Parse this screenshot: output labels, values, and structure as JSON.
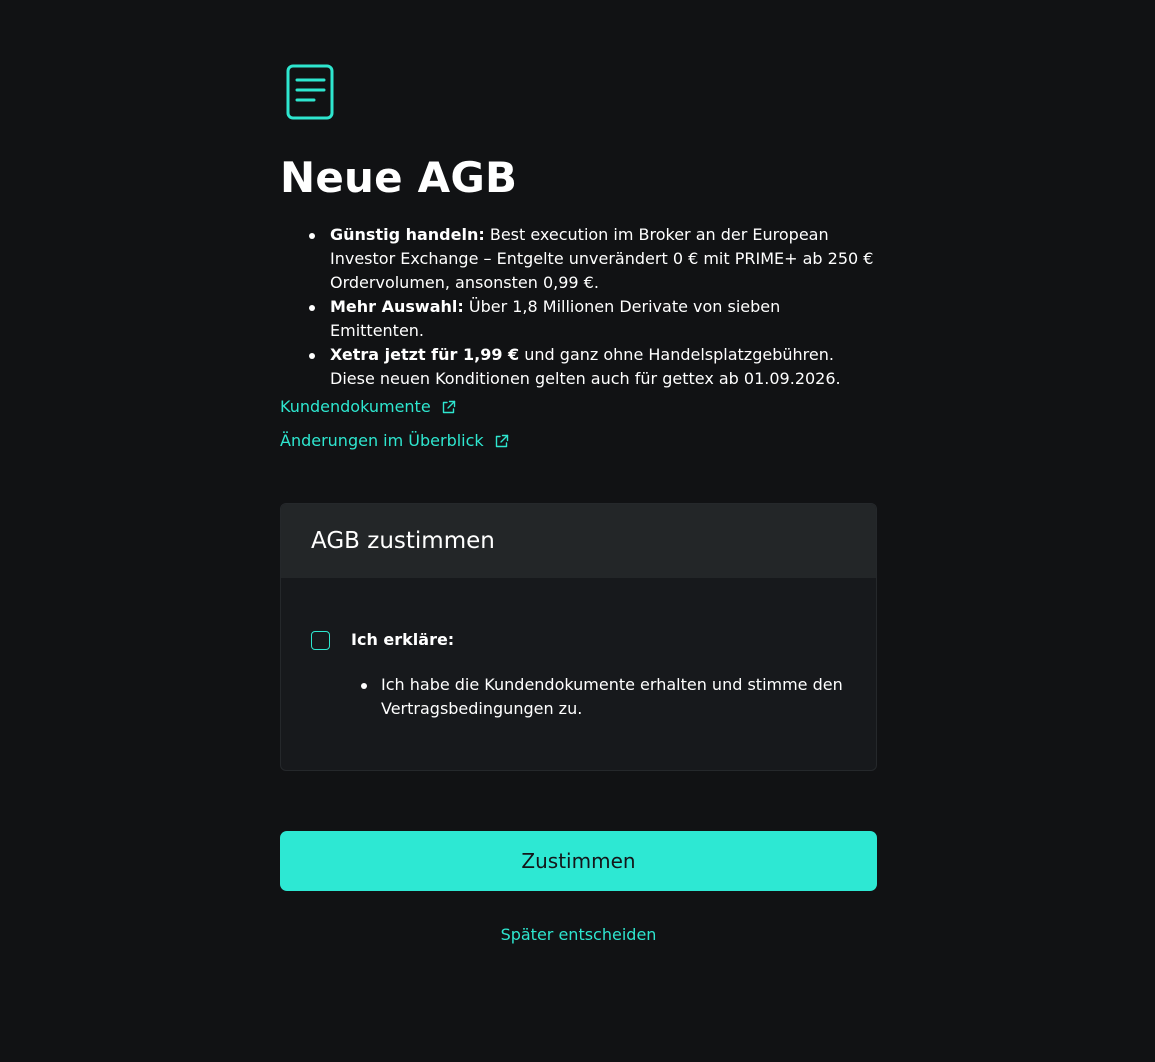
{
  "page": {
    "title": "Neue AGB",
    "icon": "document-icon",
    "accent_color": "#2ee6cf",
    "background_color": "#111214"
  },
  "bullets": [
    {
      "bold": "Günstig handeln:",
      "text": " Best execution im Broker an der European Investor Exchange – Entgelte unverändert 0 € mit PRIME+ ab 250 € Ordervolumen, ansonsten 0,99 €."
    },
    {
      "bold": "Mehr Auswahl:",
      "text": " Über 1,8 Millionen Derivate von sieben Emittenten."
    },
    {
      "bold": "Xetra jetzt für 1,99 €",
      "text": " und ganz ohne Handelsplatzgebühren. Diese neuen Konditionen gelten auch für gettex ab 01.09.2026."
    }
  ],
  "links": [
    {
      "label": "Kundendokumente",
      "icon": "external-link-icon"
    },
    {
      "label": "Änderungen im Überblick",
      "icon": "external-link-icon"
    }
  ],
  "consent_card": {
    "header": "AGB zustimmen",
    "checkbox_checked": false,
    "declare_label": "Ich erkläre:",
    "declare_items": [
      "Ich habe die Kundendokumente erhalten und stimme den Vertragsbedingungen zu."
    ]
  },
  "actions": {
    "primary_label": "Zustimmen",
    "secondary_label": "Später entscheiden"
  }
}
